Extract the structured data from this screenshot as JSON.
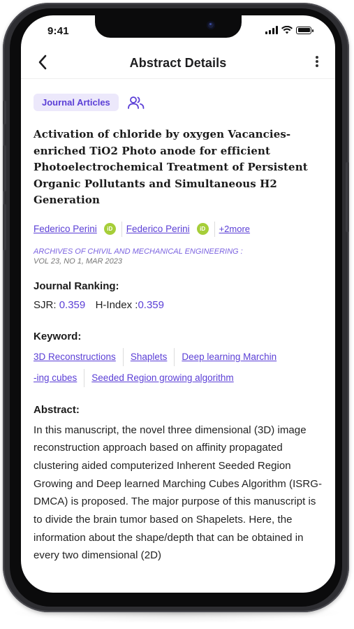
{
  "status_bar": {
    "time": "9:41"
  },
  "header": {
    "title": "Abstract Details"
  },
  "tag": {
    "label": "Journal Articles"
  },
  "article": {
    "title": "Activation of chloride by oxygen Vacancies-enriched TiO2 Photo anode for efficient Photoelectrochemical Treatment of Persistent Organic Pollutants and Simultaneous H2 Generation",
    "authors": [
      "Federico Perini",
      "Federico Perini"
    ],
    "orcid_label": "iD",
    "more_authors": "+2more",
    "journal": "ARCHIVES OF CHIVIL AND MECHANICAL ENGINEERING :",
    "volume": "VOL 23, NO 1, MAR 2023"
  },
  "ranking": {
    "heading": "Journal Ranking:",
    "sjr_label": "SJR:",
    "sjr_value": "0.359",
    "hindex_label": "H-Index :",
    "hindex_value": "0.359"
  },
  "keywords": {
    "heading": "Keyword:",
    "items": [
      "3D Reconstructions",
      "Shaplets",
      "Deep learning Marchin",
      "-ing cubes",
      "Seeded Region growing algorithm"
    ]
  },
  "abstract": {
    "heading": "Abstract:",
    "text": "In this manuscript, the novel three dimensional (3D) image reconstruction approach based on affinity propagated clustering aided computerized Inherent Seeded Region Growing and Deep learned Marching Cubes Algorithm (ISRG-DMCA) is proposed. The major purpose of this manuscript is to divide the brain tumor based on Shapelets. Here, the information about the shape/depth that can be obtained in every two dimensional (2D)"
  },
  "colors": {
    "accent": "#5b3fd6",
    "tag_bg": "#ece8fb",
    "orcid": "#a6ce39"
  },
  "icons": [
    "chevron-left-icon",
    "more-vertical-icon",
    "people-icon",
    "orcid-icon",
    "signal-icon",
    "wifi-icon",
    "battery-icon"
  ]
}
